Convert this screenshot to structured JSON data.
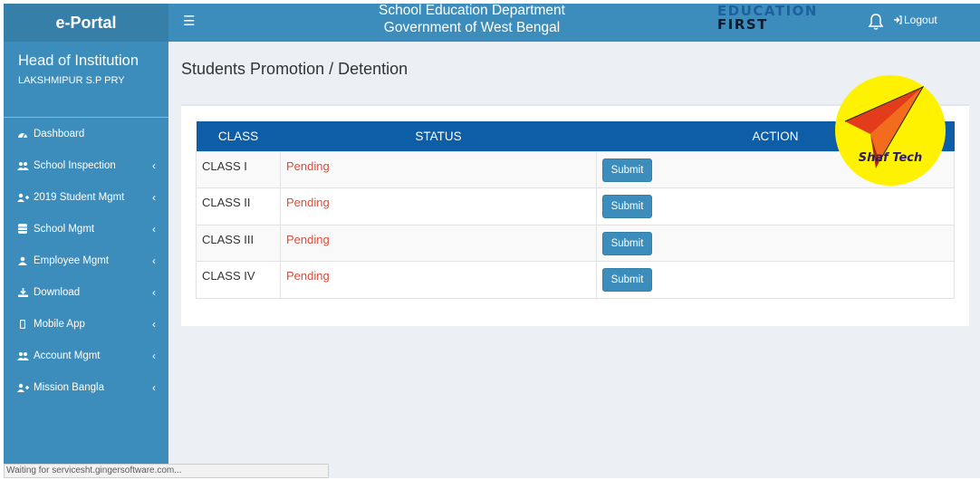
{
  "brand": "e-Portal",
  "header": {
    "dept_line1": "School Education Department",
    "dept_line2": "Government of West Bengal",
    "logo_line1": "EDUCATION",
    "logo_line2": "FIRST",
    "logout": "Logout"
  },
  "sidebar": {
    "role": "Head of Institution",
    "school": "LAKSHMIPUR S.P PRY",
    "items": [
      {
        "label": "Dashboard",
        "icon": "dashboard-icon",
        "has_submenu": false
      },
      {
        "label": "School Inspection",
        "icon": "users-icon",
        "has_submenu": true
      },
      {
        "label": "2019 Student Mgmt",
        "icon": "user-plus-icon",
        "has_submenu": true
      },
      {
        "label": "School Mgmt",
        "icon": "database-icon",
        "has_submenu": true
      },
      {
        "label": "Employee Mgmt",
        "icon": "user-icon",
        "has_submenu": true
      },
      {
        "label": "Download",
        "icon": "download-icon",
        "has_submenu": true
      },
      {
        "label": "Mobile App",
        "icon": "mobile-icon",
        "has_submenu": true
      },
      {
        "label": "Account Mgmt",
        "icon": "users-icon",
        "has_submenu": true
      },
      {
        "label": "Mission Bangla",
        "icon": "user-plus-icon",
        "has_submenu": true
      }
    ]
  },
  "page": {
    "title": "Students Promotion / Detention",
    "columns": [
      "CLASS",
      "STATUS",
      "ACTION"
    ],
    "rows": [
      {
        "class": "CLASS I",
        "status": "Pending",
        "action": "Submit"
      },
      {
        "class": "CLASS II",
        "status": "Pending",
        "action": "Submit"
      },
      {
        "class": "CLASS III",
        "status": "Pending",
        "action": "Submit"
      },
      {
        "class": "CLASS IV",
        "status": "Pending",
        "action": "Submit"
      }
    ]
  },
  "watermark": "Shaf Tech",
  "browser_status": "Waiting for servicesht.gingersoftware.com...",
  "colors": {
    "primary": "#3c8dbc",
    "brand_dark": "#367fa9",
    "table_header": "#0d5ea6",
    "pending": "#dd4b39",
    "background": "#ecf0f5"
  }
}
